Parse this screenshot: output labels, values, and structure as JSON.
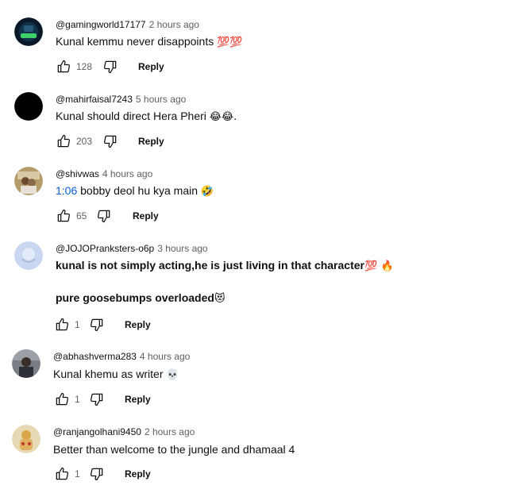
{
  "comments": [
    {
      "handle": "@gamingworld17177",
      "time": "2 hours ago",
      "text": "Kunal kemmu never disappoints",
      "emoji": "💯💯",
      "likes": "128",
      "reply": "Reply",
      "avatar_color": "#0b1a2a"
    },
    {
      "handle": "@mahirfaisal7243",
      "time": "5 hours ago",
      "text": "Kunal should direct Hera Pheri",
      "emoji": "😂😂.",
      "likes": "203",
      "reply": "Reply",
      "avatar_color": "#000000"
    },
    {
      "handle": "@shivwas",
      "time": "4 hours ago",
      "timestamp_link": "1:06",
      "text": "bobby deol hu kya main",
      "emoji": "🤣",
      "likes": "65",
      "reply": "Reply",
      "avatar_color": "#b59a6a"
    },
    {
      "handle": "@JOJOPranksters-o6p",
      "time": "3 hours ago",
      "text": "kunal is not simply acting,he is just living in that character",
      "emoji": "💯 🔥",
      "text2": "pure goosebumps overloaded",
      "emoji2": "😻",
      "likes": "1",
      "reply": "Reply",
      "avatar_color": "#c9d6ef"
    },
    {
      "handle": "@abhashverma283",
      "time": "4 hours ago",
      "text": "Kunal khemu as writer",
      "emoji": "💀",
      "likes": "1",
      "reply": "Reply",
      "avatar_color": "#7a7e84"
    },
    {
      "handle": "@ranjangolhani9450",
      "time": "2 hours ago",
      "text": "Better than welcome to the jungle and dhamaal 4",
      "likes": "1",
      "reply": "Reply",
      "avatar_color": "#e8d9b5"
    }
  ]
}
